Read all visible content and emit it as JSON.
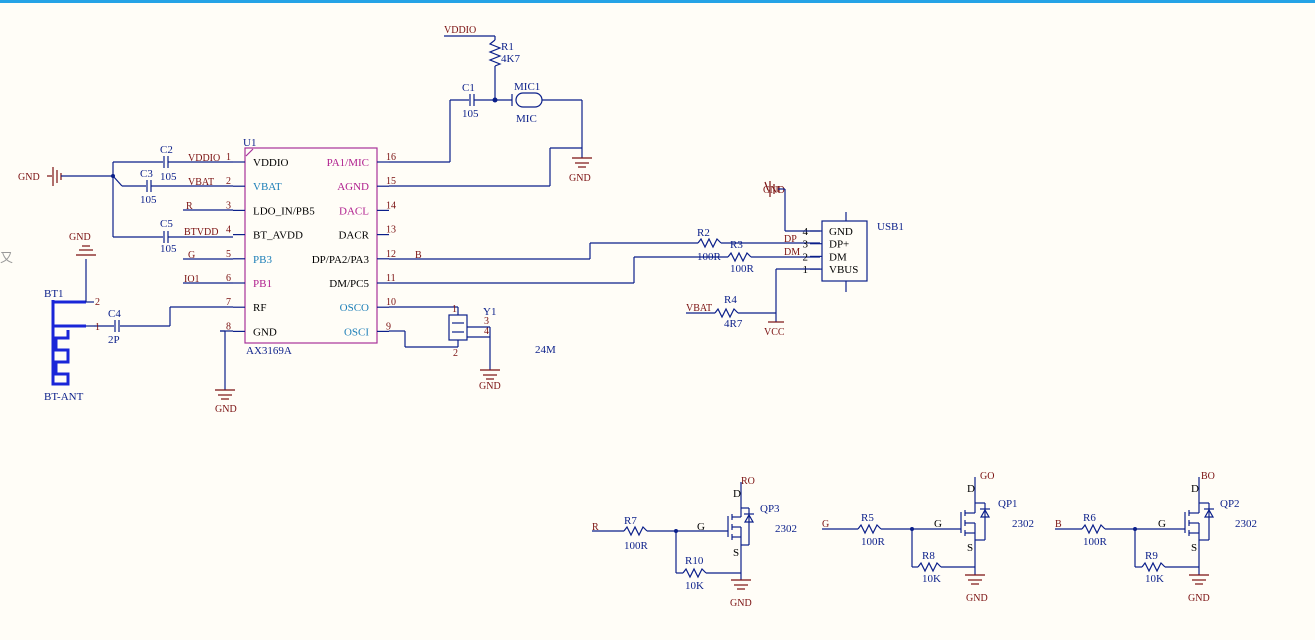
{
  "u1": {
    "designator": "U1",
    "part": "AX3169A",
    "left_pins": [
      {
        "num": "1",
        "name": "VDDIO",
        "style": "black"
      },
      {
        "num": "2",
        "name": "VBAT",
        "style": "blue"
      },
      {
        "num": "3",
        "name": "LDO_IN/PB5",
        "style": "black"
      },
      {
        "num": "4",
        "name": "BT_AVDD",
        "style": "black"
      },
      {
        "num": "5",
        "name": "PB3",
        "style": "blue"
      },
      {
        "num": "6",
        "name": "PB1",
        "style": "mag"
      },
      {
        "num": "7",
        "name": "RF",
        "style": "black"
      },
      {
        "num": "8",
        "name": "GND",
        "style": "black"
      }
    ],
    "right_pins": [
      {
        "num": "16",
        "name": "PA1/MIC",
        "style": "mag"
      },
      {
        "num": "15",
        "name": "AGND",
        "style": "mag"
      },
      {
        "num": "14",
        "name": "DACL",
        "style": "mag"
      },
      {
        "num": "13",
        "name": "DACR",
        "style": "black"
      },
      {
        "num": "12",
        "name": "DP/PA2/PA3",
        "style": "black"
      },
      {
        "num": "11",
        "name": "DM/PC5",
        "style": "black"
      },
      {
        "num": "10",
        "name": "OSCO",
        "style": "blue"
      },
      {
        "num": "9",
        "name": "OSCI",
        "style": "blue"
      }
    ]
  },
  "nets": {
    "vddio_top": "VDDIO",
    "vddio": "VDDIO",
    "vbat": "VBAT",
    "r": "R",
    "btvdd": "BTVDD",
    "g": "G",
    "io1": "IO1",
    "b": "B",
    "dp": "DP",
    "dm": "DM",
    "vbat_r4": "VBAT",
    "vcc": "VCC",
    "r_in": "R",
    "g_in": "G",
    "b_in": "B",
    "ro": "RO",
    "go": "GO",
    "bo": "BO"
  },
  "gnd_labels": {
    "left": "GND",
    "top_ant": "GND",
    "u1": "GND",
    "mic": "GND",
    "xtal": "GND",
    "usb": "GND",
    "qp3": "GND",
    "qp1": "GND",
    "qp2": "GND"
  },
  "components": {
    "r1": {
      "des": "R1",
      "val": "4K7"
    },
    "c1": {
      "des": "C1",
      "val": "105"
    },
    "mic1": {
      "des": "MIC1",
      "val": "MIC"
    },
    "c2": {
      "des": "C2",
      "val": "105"
    },
    "c3": {
      "des": "C3",
      "val": "105"
    },
    "c5": {
      "des": "C5",
      "val": "105"
    },
    "c4": {
      "des": "C4",
      "val": "2P"
    },
    "bt1": {
      "des": "BT1",
      "val": "BT-ANT",
      "pin1": "1",
      "pin2": "2"
    },
    "y1": {
      "des": "Y1",
      "val": "24M",
      "pin1": "1",
      "pin2": "2",
      "pin3": "3",
      "pin4": "4"
    },
    "r2": {
      "des": "R2",
      "val": "100R"
    },
    "r3": {
      "des": "R3",
      "val": "100R"
    },
    "r4": {
      "des": "R4",
      "val": "4R7"
    },
    "usb1": {
      "des": "USB1",
      "pins": [
        "GND",
        "DP+",
        "DM",
        "VBUS"
      ],
      "nums": [
        "4",
        "3",
        "2",
        "1"
      ]
    },
    "r7": {
      "des": "R7",
      "val": "100R"
    },
    "r10": {
      "des": "R10",
      "val": "10K"
    },
    "qp3": {
      "des": "QP3",
      "val": "2302"
    },
    "r5": {
      "des": "R5",
      "val": "100R"
    },
    "r8": {
      "des": "R8",
      "val": "10K"
    },
    "qp1": {
      "des": "QP1",
      "val": "2302"
    },
    "r6": {
      "des": "R6",
      "val": "100R"
    },
    "r9": {
      "des": "R9",
      "val": "10K"
    },
    "qp2": {
      "des": "QP2",
      "val": "2302"
    }
  },
  "mosfet_pins": {
    "g": "G",
    "d": "D",
    "s": "S"
  },
  "edge_glyph": "又"
}
